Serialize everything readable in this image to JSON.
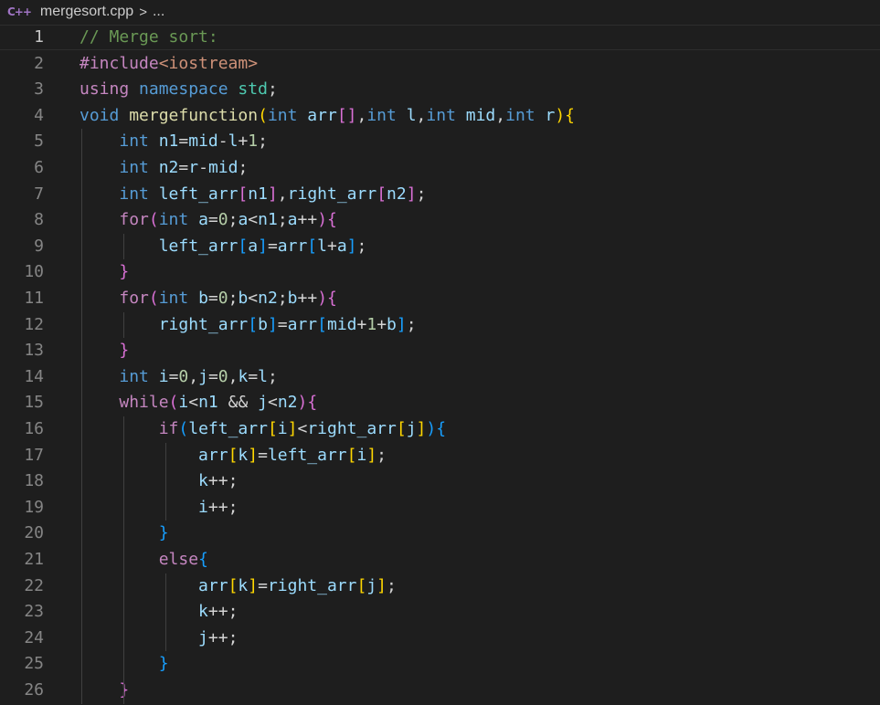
{
  "breadcrumb": {
    "file_icon": "cpp-file-icon",
    "file_icon_glyph": "C++",
    "file_name": "mergesort.cpp",
    "separator": ">",
    "more": "..."
  },
  "editor": {
    "current_line": 1,
    "lines": [
      {
        "num": "1",
        "tokens": [
          {
            "t": "// Merge sort:",
            "c": "cmt"
          }
        ]
      },
      {
        "num": "2",
        "tokens": [
          {
            "t": "#include",
            "c": "ctl"
          },
          {
            "t": "<iostream>",
            "c": "str"
          }
        ]
      },
      {
        "num": "3",
        "tokens": [
          {
            "t": "using",
            "c": "ctl"
          },
          {
            "t": " ",
            "c": "op"
          },
          {
            "t": "namespace",
            "c": "kw"
          },
          {
            "t": " ",
            "c": "op"
          },
          {
            "t": "std",
            "c": "typ"
          },
          {
            "t": ";",
            "c": "op"
          }
        ]
      },
      {
        "num": "4",
        "tokens": [
          {
            "t": "void",
            "c": "kw"
          },
          {
            "t": " ",
            "c": "op"
          },
          {
            "t": "mergefunction",
            "c": "fn"
          },
          {
            "t": "(",
            "c": "b1"
          },
          {
            "t": "int",
            "c": "kw"
          },
          {
            "t": " ",
            "c": "op"
          },
          {
            "t": "arr",
            "c": "var"
          },
          {
            "t": "[]",
            "c": "b2"
          },
          {
            "t": ",",
            "c": "op"
          },
          {
            "t": "int",
            "c": "kw"
          },
          {
            "t": " ",
            "c": "op"
          },
          {
            "t": "l",
            "c": "var"
          },
          {
            "t": ",",
            "c": "op"
          },
          {
            "t": "int",
            "c": "kw"
          },
          {
            "t": " ",
            "c": "op"
          },
          {
            "t": "mid",
            "c": "var"
          },
          {
            "t": ",",
            "c": "op"
          },
          {
            "t": "int",
            "c": "kw"
          },
          {
            "t": " ",
            "c": "op"
          },
          {
            "t": "r",
            "c": "var"
          },
          {
            "t": ")",
            "c": "b1"
          },
          {
            "t": "{",
            "c": "b1"
          }
        ]
      },
      {
        "num": "5",
        "tokens": [
          {
            "t": "    ",
            "c": "op"
          },
          {
            "t": "int",
            "c": "kw"
          },
          {
            "t": " ",
            "c": "op"
          },
          {
            "t": "n1",
            "c": "var"
          },
          {
            "t": "=",
            "c": "op"
          },
          {
            "t": "mid",
            "c": "var"
          },
          {
            "t": "-",
            "c": "op"
          },
          {
            "t": "l",
            "c": "var"
          },
          {
            "t": "+",
            "c": "op"
          },
          {
            "t": "1",
            "c": "num"
          },
          {
            "t": ";",
            "c": "op"
          }
        ]
      },
      {
        "num": "6",
        "tokens": [
          {
            "t": "    ",
            "c": "op"
          },
          {
            "t": "int",
            "c": "kw"
          },
          {
            "t": " ",
            "c": "op"
          },
          {
            "t": "n2",
            "c": "var"
          },
          {
            "t": "=",
            "c": "op"
          },
          {
            "t": "r",
            "c": "var"
          },
          {
            "t": "-",
            "c": "op"
          },
          {
            "t": "mid",
            "c": "var"
          },
          {
            "t": ";",
            "c": "op"
          }
        ]
      },
      {
        "num": "7",
        "tokens": [
          {
            "t": "    ",
            "c": "op"
          },
          {
            "t": "int",
            "c": "kw"
          },
          {
            "t": " ",
            "c": "op"
          },
          {
            "t": "left_arr",
            "c": "var"
          },
          {
            "t": "[",
            "c": "b2"
          },
          {
            "t": "n1",
            "c": "var"
          },
          {
            "t": "]",
            "c": "b2"
          },
          {
            "t": ",",
            "c": "op"
          },
          {
            "t": "right_arr",
            "c": "var"
          },
          {
            "t": "[",
            "c": "b2"
          },
          {
            "t": "n2",
            "c": "var"
          },
          {
            "t": "]",
            "c": "b2"
          },
          {
            "t": ";",
            "c": "op"
          }
        ]
      },
      {
        "num": "8",
        "tokens": [
          {
            "t": "    ",
            "c": "op"
          },
          {
            "t": "for",
            "c": "ctl"
          },
          {
            "t": "(",
            "c": "b2"
          },
          {
            "t": "int",
            "c": "kw"
          },
          {
            "t": " ",
            "c": "op"
          },
          {
            "t": "a",
            "c": "var"
          },
          {
            "t": "=",
            "c": "op"
          },
          {
            "t": "0",
            "c": "num"
          },
          {
            "t": ";",
            "c": "op"
          },
          {
            "t": "a",
            "c": "var"
          },
          {
            "t": "<",
            "c": "op"
          },
          {
            "t": "n1",
            "c": "var"
          },
          {
            "t": ";",
            "c": "op"
          },
          {
            "t": "a",
            "c": "var"
          },
          {
            "t": "++",
            "c": "op"
          },
          {
            "t": ")",
            "c": "b2"
          },
          {
            "t": "{",
            "c": "b2"
          }
        ]
      },
      {
        "num": "9",
        "tokens": [
          {
            "t": "        ",
            "c": "op"
          },
          {
            "t": "left_arr",
            "c": "var"
          },
          {
            "t": "[",
            "c": "b3"
          },
          {
            "t": "a",
            "c": "var"
          },
          {
            "t": "]",
            "c": "b3"
          },
          {
            "t": "=",
            "c": "op"
          },
          {
            "t": "arr",
            "c": "var"
          },
          {
            "t": "[",
            "c": "b3"
          },
          {
            "t": "l",
            "c": "var"
          },
          {
            "t": "+",
            "c": "op"
          },
          {
            "t": "a",
            "c": "var"
          },
          {
            "t": "]",
            "c": "b3"
          },
          {
            "t": ";",
            "c": "op"
          }
        ]
      },
      {
        "num": "10",
        "tokens": [
          {
            "t": "    ",
            "c": "op"
          },
          {
            "t": "}",
            "c": "b2"
          }
        ]
      },
      {
        "num": "11",
        "tokens": [
          {
            "t": "    ",
            "c": "op"
          },
          {
            "t": "for",
            "c": "ctl"
          },
          {
            "t": "(",
            "c": "b2"
          },
          {
            "t": "int",
            "c": "kw"
          },
          {
            "t": " ",
            "c": "op"
          },
          {
            "t": "b",
            "c": "var"
          },
          {
            "t": "=",
            "c": "op"
          },
          {
            "t": "0",
            "c": "num"
          },
          {
            "t": ";",
            "c": "op"
          },
          {
            "t": "b",
            "c": "var"
          },
          {
            "t": "<",
            "c": "op"
          },
          {
            "t": "n2",
            "c": "var"
          },
          {
            "t": ";",
            "c": "op"
          },
          {
            "t": "b",
            "c": "var"
          },
          {
            "t": "++",
            "c": "op"
          },
          {
            "t": ")",
            "c": "b2"
          },
          {
            "t": "{",
            "c": "b2"
          }
        ]
      },
      {
        "num": "12",
        "tokens": [
          {
            "t": "        ",
            "c": "op"
          },
          {
            "t": "right_arr",
            "c": "var"
          },
          {
            "t": "[",
            "c": "b3"
          },
          {
            "t": "b",
            "c": "var"
          },
          {
            "t": "]",
            "c": "b3"
          },
          {
            "t": "=",
            "c": "op"
          },
          {
            "t": "arr",
            "c": "var"
          },
          {
            "t": "[",
            "c": "b3"
          },
          {
            "t": "mid",
            "c": "var"
          },
          {
            "t": "+",
            "c": "op"
          },
          {
            "t": "1",
            "c": "num"
          },
          {
            "t": "+",
            "c": "op"
          },
          {
            "t": "b",
            "c": "var"
          },
          {
            "t": "]",
            "c": "b3"
          },
          {
            "t": ";",
            "c": "op"
          }
        ]
      },
      {
        "num": "13",
        "tokens": [
          {
            "t": "    ",
            "c": "op"
          },
          {
            "t": "}",
            "c": "b2"
          }
        ]
      },
      {
        "num": "14",
        "tokens": [
          {
            "t": "    ",
            "c": "op"
          },
          {
            "t": "int",
            "c": "kw"
          },
          {
            "t": " ",
            "c": "op"
          },
          {
            "t": "i",
            "c": "var"
          },
          {
            "t": "=",
            "c": "op"
          },
          {
            "t": "0",
            "c": "num"
          },
          {
            "t": ",",
            "c": "op"
          },
          {
            "t": "j",
            "c": "var"
          },
          {
            "t": "=",
            "c": "op"
          },
          {
            "t": "0",
            "c": "num"
          },
          {
            "t": ",",
            "c": "op"
          },
          {
            "t": "k",
            "c": "var"
          },
          {
            "t": "=",
            "c": "op"
          },
          {
            "t": "l",
            "c": "var"
          },
          {
            "t": ";",
            "c": "op"
          }
        ]
      },
      {
        "num": "15",
        "tokens": [
          {
            "t": "    ",
            "c": "op"
          },
          {
            "t": "while",
            "c": "ctl"
          },
          {
            "t": "(",
            "c": "b2"
          },
          {
            "t": "i",
            "c": "var"
          },
          {
            "t": "<",
            "c": "op"
          },
          {
            "t": "n1",
            "c": "var"
          },
          {
            "t": " && ",
            "c": "op"
          },
          {
            "t": "j",
            "c": "var"
          },
          {
            "t": "<",
            "c": "op"
          },
          {
            "t": "n2",
            "c": "var"
          },
          {
            "t": ")",
            "c": "b2"
          },
          {
            "t": "{",
            "c": "b2"
          }
        ]
      },
      {
        "num": "16",
        "tokens": [
          {
            "t": "        ",
            "c": "op"
          },
          {
            "t": "if",
            "c": "ctl"
          },
          {
            "t": "(",
            "c": "b3"
          },
          {
            "t": "left_arr",
            "c": "var"
          },
          {
            "t": "[",
            "c": "b1"
          },
          {
            "t": "i",
            "c": "var"
          },
          {
            "t": "]",
            "c": "b1"
          },
          {
            "t": "<",
            "c": "op"
          },
          {
            "t": "right_arr",
            "c": "var"
          },
          {
            "t": "[",
            "c": "b1"
          },
          {
            "t": "j",
            "c": "var"
          },
          {
            "t": "]",
            "c": "b1"
          },
          {
            "t": ")",
            "c": "b3"
          },
          {
            "t": "{",
            "c": "b3"
          }
        ]
      },
      {
        "num": "17",
        "tokens": [
          {
            "t": "            ",
            "c": "op"
          },
          {
            "t": "arr",
            "c": "var"
          },
          {
            "t": "[",
            "c": "b1"
          },
          {
            "t": "k",
            "c": "var"
          },
          {
            "t": "]",
            "c": "b1"
          },
          {
            "t": "=",
            "c": "op"
          },
          {
            "t": "left_arr",
            "c": "var"
          },
          {
            "t": "[",
            "c": "b1"
          },
          {
            "t": "i",
            "c": "var"
          },
          {
            "t": "]",
            "c": "b1"
          },
          {
            "t": ";",
            "c": "op"
          }
        ]
      },
      {
        "num": "18",
        "tokens": [
          {
            "t": "            ",
            "c": "op"
          },
          {
            "t": "k",
            "c": "var"
          },
          {
            "t": "++;",
            "c": "op"
          }
        ]
      },
      {
        "num": "19",
        "tokens": [
          {
            "t": "            ",
            "c": "op"
          },
          {
            "t": "i",
            "c": "var"
          },
          {
            "t": "++;",
            "c": "op"
          }
        ]
      },
      {
        "num": "20",
        "tokens": [
          {
            "t": "        ",
            "c": "op"
          },
          {
            "t": "}",
            "c": "b3"
          }
        ]
      },
      {
        "num": "21",
        "tokens": [
          {
            "t": "        ",
            "c": "op"
          },
          {
            "t": "else",
            "c": "ctl"
          },
          {
            "t": "{",
            "c": "b3"
          }
        ]
      },
      {
        "num": "22",
        "tokens": [
          {
            "t": "            ",
            "c": "op"
          },
          {
            "t": "arr",
            "c": "var"
          },
          {
            "t": "[",
            "c": "b1"
          },
          {
            "t": "k",
            "c": "var"
          },
          {
            "t": "]",
            "c": "b1"
          },
          {
            "t": "=",
            "c": "op"
          },
          {
            "t": "right_arr",
            "c": "var"
          },
          {
            "t": "[",
            "c": "b1"
          },
          {
            "t": "j",
            "c": "var"
          },
          {
            "t": "]",
            "c": "b1"
          },
          {
            "t": ";",
            "c": "op"
          }
        ]
      },
      {
        "num": "23",
        "tokens": [
          {
            "t": "            ",
            "c": "op"
          },
          {
            "t": "k",
            "c": "var"
          },
          {
            "t": "++;",
            "c": "op"
          }
        ]
      },
      {
        "num": "24",
        "tokens": [
          {
            "t": "            ",
            "c": "op"
          },
          {
            "t": "j",
            "c": "var"
          },
          {
            "t": "++;",
            "c": "op"
          }
        ]
      },
      {
        "num": "25",
        "tokens": [
          {
            "t": "        ",
            "c": "op"
          },
          {
            "t": "}",
            "c": "b3"
          }
        ]
      },
      {
        "num": "26",
        "tokens": [
          {
            "t": "    ",
            "c": "op"
          },
          {
            "t": "}",
            "c": "b2"
          }
        ]
      }
    ]
  }
}
